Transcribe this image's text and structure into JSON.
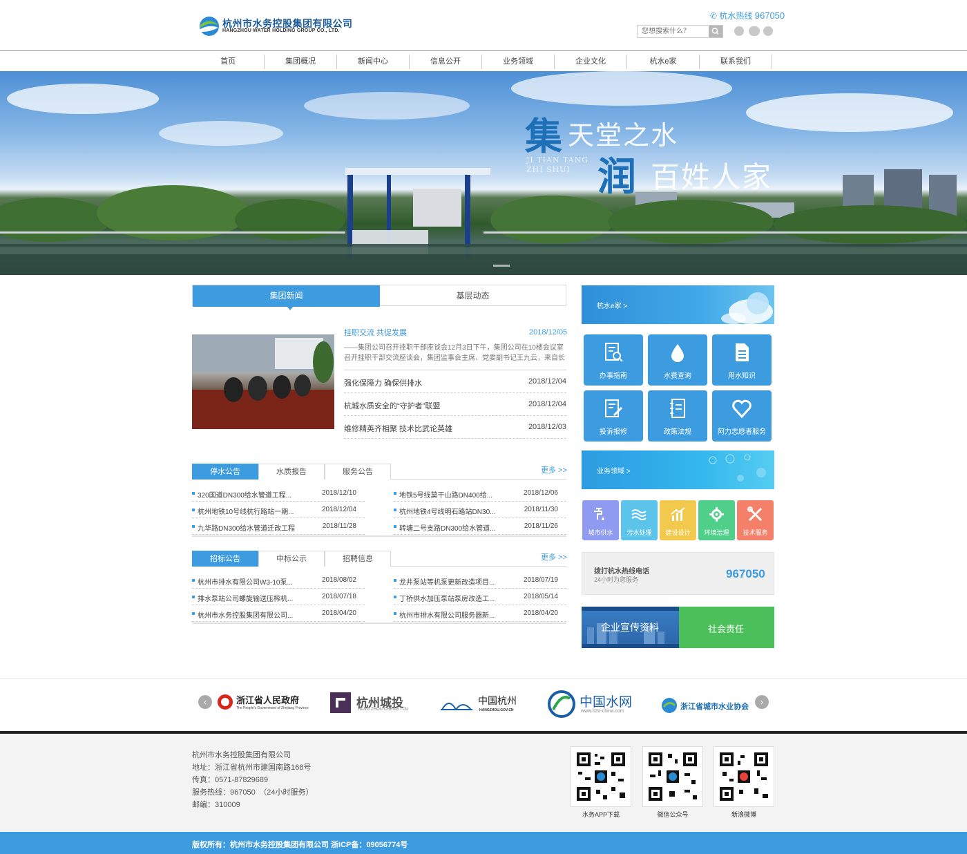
{
  "header": {
    "company_cn": "杭州市水务控股集团有限公司",
    "company_en": "HANGZHOU WATER HOLDING GROUP CO., LTD.",
    "hotline_label": "杭水热线",
    "hotline_number": "967050",
    "search_placeholder": "您想搜索什么？"
  },
  "nav": [
    "首页",
    "集团概况",
    "新闻中心",
    "信息公开",
    "业务领域",
    "企业文化",
    "杭水e家",
    "联系我们"
  ],
  "banner": {
    "line1_big": "集",
    "line1_rest": "天堂之水",
    "line2_big": "润",
    "line2_rest": "百姓人家",
    "pinyin1": "JI TIAN TANG",
    "pinyin2": "ZHI SHUI"
  },
  "news": {
    "tabs": [
      "集团新闻",
      "基层动态"
    ],
    "featured": {
      "title": "挂职交流 共促发展",
      "date": "2018/12/05",
      "summary": "——集团公司召开挂职干部座谈会12月3日下午，集团公司在10楼会议室召开挂职干部交流座谈会，集团监事会主席、党委副书记王九云，来自长春和"
    },
    "items": [
      {
        "title": "强化保障力 确保供排水",
        "date": "2018/12/04"
      },
      {
        "title": "杭城水质安全的“守护者”联盟",
        "date": "2018/12/04"
      },
      {
        "title": "维修精英齐相聚 技术比武论英雄",
        "date": "2018/12/03"
      }
    ]
  },
  "notices": {
    "tabs": [
      "停水公告",
      "水质报告",
      "服务公告"
    ],
    "more": "更多 >>",
    "left": [
      {
        "title": "320国道DN300给水管道工程...",
        "date": "2018/12/10"
      },
      {
        "title": "杭州地铁10号线杭行路站一期...",
        "date": "2018/12/04"
      },
      {
        "title": "九华路DN300给水管道迁改工程",
        "date": "2018/11/28"
      }
    ],
    "right": [
      {
        "title": "地铁5号线莫干山路DN400给...",
        "date": "2018/12/06"
      },
      {
        "title": "杭州地铁4号线明石路站DN30...",
        "date": "2018/11/30"
      },
      {
        "title": "转塘二号支路DN300给水管道...",
        "date": "2018/11/26"
      }
    ]
  },
  "bids": {
    "tabs": [
      "招标公告",
      "中标公示",
      "招聘信息"
    ],
    "more": "更多 >>",
    "left": [
      {
        "title": "杭州市排水有限公司W3-10泵...",
        "date": "2018/08/02"
      },
      {
        "title": "排水泵站公司螺旋输送压榨机...",
        "date": "2018/07/18"
      },
      {
        "title": "杭州市水务控股集团有限公司...",
        "date": "2018/04/20"
      }
    ],
    "right": [
      {
        "title": "龙井泵站等机泵更新改造项目...",
        "date": "2018/07/19"
      },
      {
        "title": "丁桥供水加压泵站泵房改造工...",
        "date": "2018/05/14"
      },
      {
        "title": "杭州市排水有限公司服务器新...",
        "date": "2018/04/20"
      }
    ]
  },
  "sidebar": {
    "ehome_label": "杭水e家 >",
    "services": [
      "办事指南",
      "水费查询",
      "用水知识",
      "投诉报修",
      "政策法规",
      "阿力志愿者服务"
    ],
    "business_label": "业务领域 >",
    "business": [
      {
        "label": "城市供水",
        "color": "#8f9bf0"
      },
      {
        "label": "污水处理",
        "color": "#5cc3ea"
      },
      {
        "label": "建设设计",
        "color": "#f2c94c"
      },
      {
        "label": "环境治理",
        "color": "#4fcf8a"
      },
      {
        "label": "技术服务",
        "color": "#f5806a"
      }
    ],
    "hotline_title": "拨打杭水热线电话",
    "hotline_sub": "24小时为您服务",
    "hotline_number": "967050",
    "promo_left": "企业宣传资料",
    "promo_right": "社会责任"
  },
  "partners": [
    {
      "name": "浙江省人民政府",
      "sub": "The People's Government of Zhejiang Province"
    },
    {
      "name": "杭州城投",
      "sub": "HANG ZHOU CHENG TOU"
    },
    {
      "name": "中国杭州",
      "sub": "HANGZHOU.GOV.CN"
    },
    {
      "name": "中国水网",
      "sub": "www.h2o-china.com"
    },
    {
      "name": "浙江省城市水业协会",
      "sub": ""
    }
  ],
  "footer": {
    "company": "杭州市水务控股集团有限公司",
    "address": "地址：浙江省杭州市建国南路168号",
    "fax": "传真：0571-87829689",
    "service": "服务热线：967050　（24小时服务）",
    "zip": "邮编：310009",
    "qr": [
      "水务APP下载",
      "微信公众号",
      "新浪微博"
    ],
    "copyright": "版权所有：杭州市水务控股集团有限公司 浙ICP备：09056774号"
  }
}
